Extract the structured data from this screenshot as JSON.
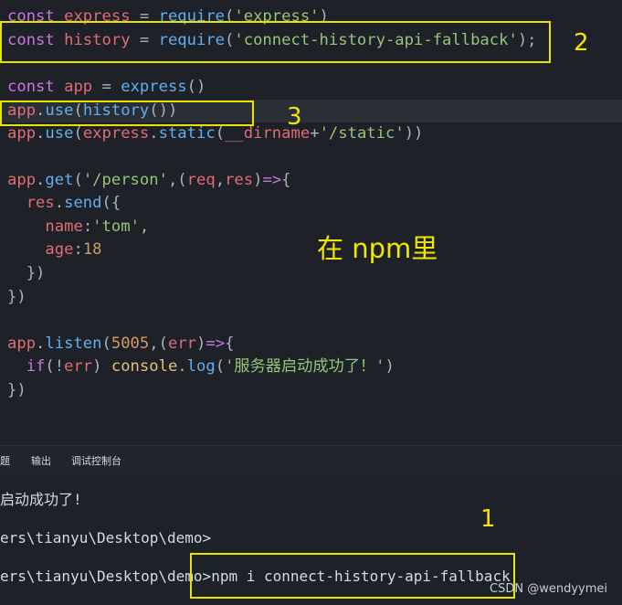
{
  "code_lines": [
    {
      "tokens": [
        [
          "kw",
          "const"
        ],
        [
          "pl",
          " "
        ],
        [
          "var",
          "express"
        ],
        [
          "pl",
          " = "
        ],
        [
          "fn",
          "require"
        ],
        [
          "pl",
          "("
        ],
        [
          "str",
          "'express'"
        ],
        [
          "pl",
          ")"
        ]
      ]
    },
    {
      "tokens": [
        [
          "kw",
          "const"
        ],
        [
          "pl",
          " "
        ],
        [
          "var",
          "history"
        ],
        [
          "pl",
          " = "
        ],
        [
          "fn",
          "require"
        ],
        [
          "pl",
          "("
        ],
        [
          "str",
          "'connect-history-api-fallback'"
        ],
        [
          "pl",
          ");"
        ]
      ]
    },
    {
      "tokens": []
    },
    {
      "tokens": [
        [
          "kw",
          "const"
        ],
        [
          "pl",
          " "
        ],
        [
          "var",
          "app"
        ],
        [
          "pl",
          " = "
        ],
        [
          "fn",
          "express"
        ],
        [
          "pl",
          "()"
        ]
      ]
    },
    {
      "tokens": [
        [
          "var",
          "app"
        ],
        [
          "pl",
          "."
        ],
        [
          "fn",
          "use"
        ],
        [
          "pl",
          "("
        ],
        [
          "fn",
          "history"
        ],
        [
          "pl",
          "())"
        ]
      ]
    },
    {
      "tokens": [
        [
          "var",
          "app"
        ],
        [
          "pl",
          "."
        ],
        [
          "fn",
          "use"
        ],
        [
          "pl",
          "("
        ],
        [
          "var",
          "express"
        ],
        [
          "pl",
          "."
        ],
        [
          "fn",
          "static"
        ],
        [
          "pl",
          "("
        ],
        [
          "var",
          "__dirname"
        ],
        [
          "pl",
          "+"
        ],
        [
          "str",
          "'/static'"
        ],
        [
          "pl",
          "))"
        ]
      ]
    },
    {
      "tokens": []
    },
    {
      "tokens": [
        [
          "var",
          "app"
        ],
        [
          "pl",
          "."
        ],
        [
          "fn",
          "get"
        ],
        [
          "pl",
          "("
        ],
        [
          "str",
          "'/person'"
        ],
        [
          "pl",
          ",("
        ],
        [
          "param",
          "req"
        ],
        [
          "pl",
          ","
        ],
        [
          "param",
          "res"
        ],
        [
          "pl",
          ")"
        ],
        [
          "kw",
          "=>"
        ],
        [
          "pl",
          "{"
        ]
      ]
    },
    {
      "tokens": [
        [
          "pl",
          "  "
        ],
        [
          "var",
          "res"
        ],
        [
          "pl",
          "."
        ],
        [
          "fn",
          "send"
        ],
        [
          "pl",
          "({"
        ]
      ]
    },
    {
      "tokens": [
        [
          "pl",
          "    "
        ],
        [
          "prop",
          "name"
        ],
        [
          "pl",
          ":"
        ],
        [
          "str",
          "'tom'"
        ],
        [
          "pl",
          ","
        ]
      ]
    },
    {
      "tokens": [
        [
          "pl",
          "    "
        ],
        [
          "prop",
          "age"
        ],
        [
          "pl",
          ":"
        ],
        [
          "num",
          "18"
        ]
      ]
    },
    {
      "tokens": [
        [
          "pl",
          "  })"
        ]
      ]
    },
    {
      "tokens": [
        [
          "pl",
          "})"
        ]
      ]
    },
    {
      "tokens": []
    },
    {
      "tokens": [
        [
          "var",
          "app"
        ],
        [
          "pl",
          "."
        ],
        [
          "fn",
          "listen"
        ],
        [
          "pl",
          "("
        ],
        [
          "num",
          "5005"
        ],
        [
          "pl",
          ",("
        ],
        [
          "param",
          "err"
        ],
        [
          "pl",
          ")"
        ],
        [
          "kw",
          "=>"
        ],
        [
          "pl",
          "{"
        ]
      ]
    },
    {
      "tokens": [
        [
          "pl",
          "  "
        ],
        [
          "kw",
          "if"
        ],
        [
          "pl",
          "(!"
        ],
        [
          "param",
          "err"
        ],
        [
          "pl",
          ") "
        ],
        [
          "obj",
          "console"
        ],
        [
          "pl",
          "."
        ],
        [
          "fn",
          "log"
        ],
        [
          "pl",
          "("
        ],
        [
          "str",
          "'服务器启动成功了！'"
        ],
        [
          "pl",
          ")"
        ]
      ]
    },
    {
      "tokens": [
        [
          "pl",
          "})"
        ]
      ]
    }
  ],
  "annotations": {
    "num1": "1",
    "num2": "2",
    "num3": "3",
    "note": "在 npm里"
  },
  "panel_tabs": [
    "题",
    "输出",
    "调试控制台"
  ],
  "terminal_lines": [
    "启动成功了!",
    "ers\\tianyu\\Desktop\\demo>",
    "ers\\tianyu\\Desktop\\demo>npm i connect-history-api-fallback"
  ],
  "watermark": "CSDN @wendyymei",
  "colors": {
    "highlight_box": "#e8e300",
    "annotation_text": "#f1e600",
    "editor_bg": "#1e2127"
  }
}
